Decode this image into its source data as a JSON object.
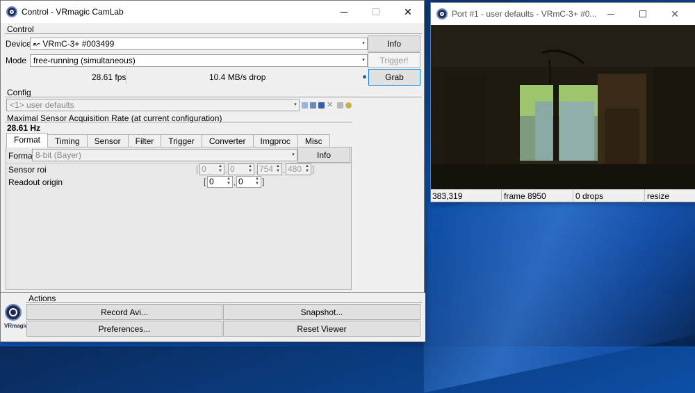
{
  "control_window": {
    "title": "Control - VRmagic CamLab",
    "control_group": {
      "label": "Control",
      "device_label": "Device",
      "device_value": "↜ VRmC-3+ #003499",
      "info_button": "Info",
      "mode_label": "Mode",
      "mode_value": "free-running (simultaneous)",
      "trigger_button": "Trigger!",
      "fps": "28.61 fps",
      "throughput": "10.4 MB/s drop",
      "grab_button": "Grab"
    },
    "config_group": {
      "label": "Config",
      "config_value": "<1> user defaults",
      "rate_label": "Maximal Sensor Acquisition Rate (at current configuration)",
      "rate_value": "28.61 Hz",
      "tabs": [
        "Format",
        "Timing",
        "Sensor",
        "Filter",
        "Trigger",
        "Converter",
        "Imgproc",
        "Misc"
      ],
      "active_tab": "Format",
      "format": {
        "format_label": "Format",
        "format_value": "8-bit (Bayer)",
        "info_button": "Info",
        "sensor_roi_label": "Sensor roi",
        "roi_values": [
          "0",
          "0",
          "754",
          "480"
        ],
        "readout_origin_label": "Readout origin",
        "origin_values": [
          "0",
          "0"
        ]
      }
    },
    "actions": {
      "label": "Actions",
      "record_avi": "Record Avi...",
      "snapshot": "Snapshot...",
      "preferences": "Preferences...",
      "reset_viewer": "Reset Viewer"
    },
    "logo_text": "VRmagic"
  },
  "port_window": {
    "title": "Port #1 - user defaults - VRmC-3+ #0...",
    "status": {
      "coords": "383,319",
      "frame": "frame 8950",
      "drops": "0 drops",
      "resize": "resize"
    }
  }
}
